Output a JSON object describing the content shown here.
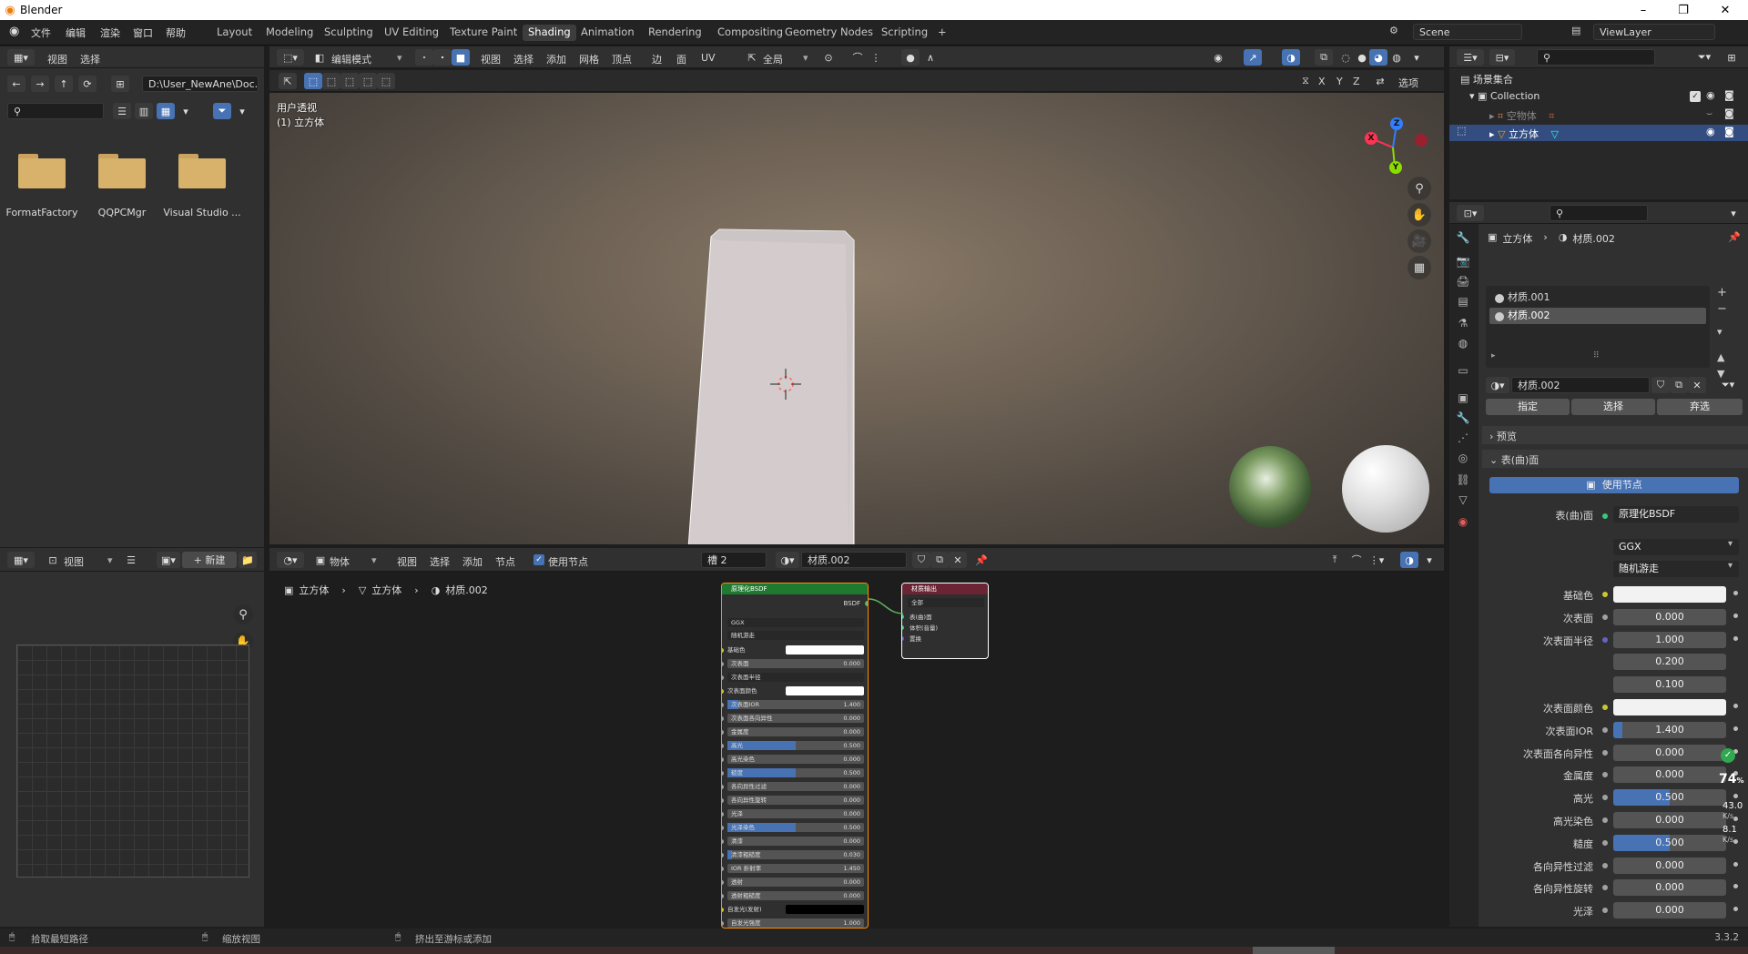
{
  "titlebar": {
    "title": "Blender",
    "minimize": "–",
    "restore": "❐",
    "close": "✕"
  },
  "topmenu": [
    "文件",
    "编辑",
    "渲染",
    "窗口",
    "帮助"
  ],
  "workspaces": [
    "Layout",
    "Modeling",
    "Sculpting",
    "UV Editing",
    "Texture Paint",
    "Shading",
    "Animation",
    "Rendering",
    "Compositing",
    "Geometry Nodes",
    "Scripting",
    "+"
  ],
  "scene": {
    "name": "Scene",
    "viewlayer": "ViewLayer"
  },
  "filebrowser": {
    "menu_view": "视图",
    "menu_select": "选择",
    "path": "D:\\User_NewAne\\Doc...",
    "folders": [
      "FormatFactory",
      "QQPCMgr",
      "Visual Studio ..."
    ]
  },
  "viewport_header": {
    "mode": "编辑模式",
    "view": "视图",
    "select": "选择",
    "add": "添加",
    "mesh": "网格",
    "vertex": "顶点",
    "edge": "边",
    "face": "面",
    "uv": "UV",
    "global": "全局",
    "options": "选项",
    "axes": [
      "X",
      "Y",
      "Z"
    ]
  },
  "viewport": {
    "view_label": "用户透视",
    "object_label": "(1) 立方体",
    "gizmo": {
      "x": "X",
      "y": "Y",
      "z": "Z"
    }
  },
  "image_editor": {
    "view": "视图",
    "new": "新建"
  },
  "node_header": {
    "object": "物体",
    "view": "视图",
    "select": "选择",
    "add": "添加",
    "node": "节点",
    "use_nodes": "使用节点",
    "slot": "槽 2",
    "material": "材质.002"
  },
  "node_breadcrumb": [
    "立方体",
    "立方体",
    "材质.002"
  ],
  "bsdf_node": {
    "title": "原理化BSDF",
    "output": "BSDF",
    "dist": "GGX",
    "sss": "随机游走",
    "rows": [
      {
        "label": "基础色",
        "value": "",
        "fill": 0,
        "type": "color",
        "color": "#ffffff"
      },
      {
        "label": "次表面",
        "value": "0.000",
        "fill": 0
      },
      {
        "label": "次表面半径",
        "value": "",
        "fill": 0,
        "type": "dropdown"
      },
      {
        "label": "次表面颜色",
        "value": "",
        "fill": 0,
        "type": "color",
        "color": "#ffffff"
      },
      {
        "label": "次表面IOR",
        "value": "1.400",
        "fill": 0.08
      },
      {
        "label": "次表面各向异性",
        "value": "0.000",
        "fill": 0
      },
      {
        "label": "金属度",
        "value": "0.000",
        "fill": 0
      },
      {
        "label": "高光",
        "value": "0.500",
        "fill": 0.5
      },
      {
        "label": "高光染色",
        "value": "0.000",
        "fill": 0
      },
      {
        "label": "糙度",
        "value": "0.500",
        "fill": 0.5
      },
      {
        "label": "各向异性过滤",
        "value": "0.000",
        "fill": 0
      },
      {
        "label": "各向异性旋转",
        "value": "0.000",
        "fill": 0
      },
      {
        "label": "光泽",
        "value": "0.000",
        "fill": 0
      },
      {
        "label": "光泽染色",
        "value": "0.500",
        "fill": 0.5
      },
      {
        "label": "清漆",
        "value": "0.000",
        "fill": 0
      },
      {
        "label": "清漆粗糙度",
        "value": "0.030",
        "fill": 0.03
      },
      {
        "label": "IOR 折射率",
        "value": "1.450",
        "fill": 0
      },
      {
        "label": "透射",
        "value": "0.000",
        "fill": 0
      },
      {
        "label": "透射粗糙度",
        "value": "0.000",
        "fill": 0
      },
      {
        "label": "自发光(发射)",
        "value": "",
        "fill": 0,
        "type": "color",
        "color": "#000000"
      },
      {
        "label": "自发光强度",
        "value": "1.000",
        "fill": 0
      }
    ]
  },
  "output_node": {
    "title": "材质输出",
    "target": "全部",
    "sockets": [
      "表(曲)面",
      "体积(音量)",
      "置换"
    ]
  },
  "outliner": {
    "root": "场景集合",
    "collection": "Collection",
    "items": [
      {
        "name": "空物体"
      },
      {
        "name": "立方体"
      }
    ]
  },
  "properties": {
    "breadcrumb_object": "立方体",
    "breadcrumb_material": "材质.002",
    "slots": [
      "材质.001",
      "材质.002"
    ],
    "material_name": "材质.002",
    "assign": "指定",
    "select": "选择",
    "deselect": "弃选",
    "preview": "预览",
    "surface_panel": "表(曲)面",
    "use_nodes": "使用节点",
    "surface_label": "表(曲)面",
    "surface_value": "原理化BSDF",
    "dist": "GGX",
    "sss": "随机游走",
    "rows": [
      {
        "label": "基础色",
        "type": "color",
        "color": "#f2f2f2",
        "dot": "#c8c832"
      },
      {
        "label": "次表面",
        "value": "0.000",
        "fill": 0,
        "dot": "#a1a1a1"
      },
      {
        "label": "次表面半径",
        "value": "1.000",
        "fill": 0,
        "dot": "#6363c7"
      },
      {
        "label": "",
        "value": "0.200",
        "fill": 0
      },
      {
        "label": "",
        "value": "0.100",
        "fill": 0
      },
      {
        "label": "次表面颜色",
        "type": "color",
        "color": "#f2f2f2",
        "dot": "#c8c832"
      },
      {
        "label": "次表面IOR",
        "value": "1.400",
        "fill": 0.08,
        "dot": "#a1a1a1"
      },
      {
        "label": "次表面各向异性",
        "value": "0.000",
        "fill": 0,
        "dot": "#a1a1a1"
      },
      {
        "label": "金属度",
        "value": "0.000",
        "fill": 0,
        "dot": "#a1a1a1"
      },
      {
        "label": "高光",
        "value": "0.500",
        "fill": 0.5,
        "dot": "#a1a1a1"
      },
      {
        "label": "高光染色",
        "value": "0.000",
        "fill": 0,
        "dot": "#a1a1a1"
      },
      {
        "label": "糙度",
        "value": "0.500",
        "fill": 0.5,
        "dot": "#a1a1a1"
      },
      {
        "label": "各向异性过滤",
        "value": "0.000",
        "fill": 0,
        "dot": "#a1a1a1"
      },
      {
        "label": "各向异性旋转",
        "value": "0.000",
        "fill": 0,
        "dot": "#a1a1a1"
      },
      {
        "label": "光泽",
        "value": "0.000",
        "fill": 0,
        "dot": "#a1a1a1"
      }
    ]
  },
  "overlay_widget": {
    "percent": "74",
    "pct_sign": "%",
    "up": "43.0",
    "up_unit": "K/s",
    "down": "8.1",
    "down_unit": "K/s"
  },
  "statusbar": {
    "left": "拾取最短路径",
    "mid": "缩放视图",
    "right": "挤出至游标或添加",
    "version": "3.3.2"
  }
}
